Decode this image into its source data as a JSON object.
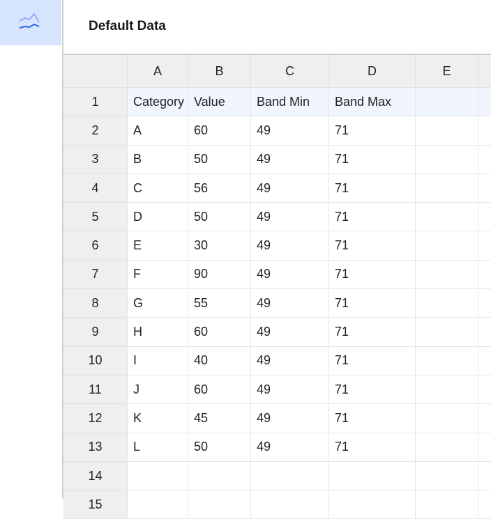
{
  "sidebar": {
    "items": [
      {
        "icon": "line-chart-icon",
        "active": true
      }
    ]
  },
  "title": "Default Data",
  "columns": [
    "A",
    "B",
    "C",
    "D",
    "E",
    ""
  ],
  "rows": [
    [
      "Category",
      "Value",
      "Band Min",
      "Band Max",
      "",
      ""
    ],
    [
      "A",
      "60",
      "49",
      "71",
      "",
      ""
    ],
    [
      "B",
      "50",
      "49",
      "71",
      "",
      ""
    ],
    [
      "C",
      "56",
      "49",
      "71",
      "",
      ""
    ],
    [
      "D",
      "50",
      "49",
      "71",
      "",
      ""
    ],
    [
      "E",
      "30",
      "49",
      "71",
      "",
      ""
    ],
    [
      "F",
      "90",
      "49",
      "71",
      "",
      ""
    ],
    [
      "G",
      "55",
      "49",
      "71",
      "",
      ""
    ],
    [
      "H",
      "60",
      "49",
      "71",
      "",
      ""
    ],
    [
      "I",
      "40",
      "49",
      "71",
      "",
      ""
    ],
    [
      "J",
      "60",
      "49",
      "71",
      "",
      ""
    ],
    [
      "K",
      "45",
      "49",
      "71",
      "",
      ""
    ],
    [
      "L",
      "50",
      "49",
      "71",
      "",
      ""
    ],
    [
      "",
      "",
      "",
      "",
      "",
      ""
    ],
    [
      "",
      "",
      "",
      "",
      "",
      ""
    ]
  ],
  "row_numbers": [
    "1",
    "2",
    "3",
    "4",
    "5",
    "6",
    "7",
    "8",
    "9",
    "10",
    "11",
    "12",
    "13",
    "14",
    "15"
  ],
  "colors": {
    "active_sidebar": "#d6e4fd",
    "icon": "#3b6fe8",
    "header_row": "#f0f5fe"
  }
}
